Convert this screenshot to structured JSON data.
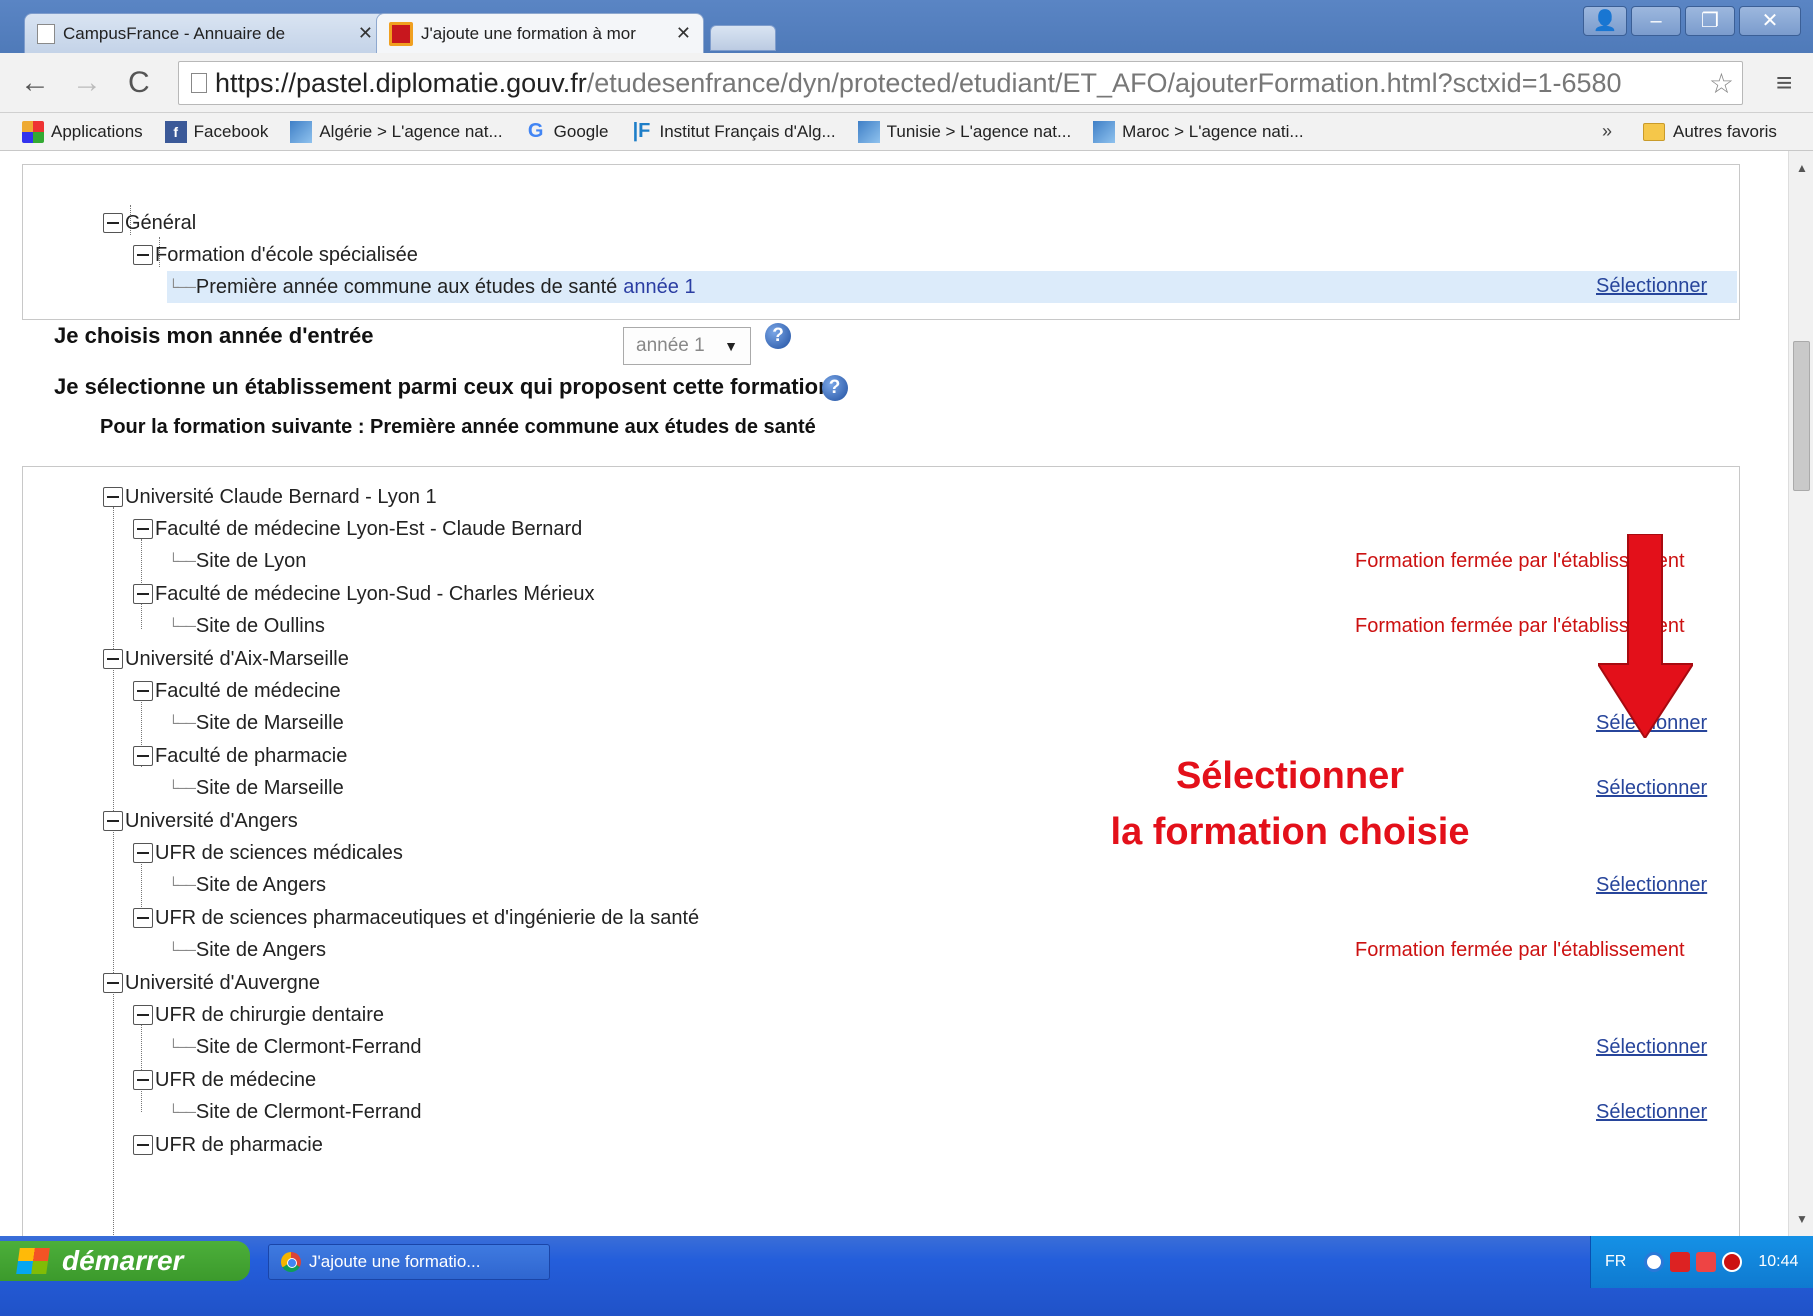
{
  "browser": {
    "tabs": [
      {
        "title": "CampusFrance - Annuaire de",
        "close": "✕"
      },
      {
        "title": "J'ajoute une formation à mor",
        "close": "✕"
      }
    ],
    "url_host": "https://pastel.diplomatie.gouv.fr",
    "url_path": "/etudesenfrance/dyn/protected/etudiant/ET_AFO/ajouterFormation.html?sctxid=1-6580",
    "bookmarks": [
      {
        "label": "Applications",
        "icon": "apps-icon"
      },
      {
        "label": "Facebook",
        "icon": "facebook-icon"
      },
      {
        "label": "Algérie > L'agence nat...",
        "icon": "flag-icon"
      },
      {
        "label": "Google",
        "icon": "google-icon"
      },
      {
        "label": "Institut Français d'Alg...",
        "icon": "if-icon"
      },
      {
        "label": "Tunisie > L'agence nat...",
        "icon": "flag-icon"
      },
      {
        "label": "Maroc > L'agence nati...",
        "icon": "flag-icon"
      }
    ],
    "bookmarks_more": "»",
    "other_bookmarks": "Autres favoris"
  },
  "formation_tree": {
    "root": "Général",
    "child": "Formation d'école spécialisée",
    "leaf": "Première année commune aux études de santé",
    "leaf_year": "année 1",
    "select_label": "Sélectionner"
  },
  "year_section": {
    "label": "Je choisis mon année d'entrée",
    "selected": "année 1"
  },
  "establishment_heading": "Je sélectionne un établissement parmi ceux qui proposent cette formation",
  "for_formation": "Pour la formation suivante : Première année commune aux études de santé",
  "etablissements": [
    {
      "label": "Université Claude Bernard - Lyon 1"
    },
    {
      "label": "Faculté de médecine Lyon-Est - Claude Bernard"
    },
    {
      "label": "Site de Lyon",
      "status": "Formation fermée par l'établissement"
    },
    {
      "label": "Faculté de médecine Lyon-Sud - Charles Mérieux"
    },
    {
      "label": "Site de Oullins",
      "status": "Formation fermée par l'établissement"
    },
    {
      "label": "Université d'Aix-Marseille"
    },
    {
      "label": "Faculté de médecine"
    },
    {
      "label": "Site de Marseille",
      "action": "Sélectionner"
    },
    {
      "label": "Faculté de pharmacie"
    },
    {
      "label": "Site de Marseille",
      "action": "Sélectionner"
    },
    {
      "label": "Université d'Angers"
    },
    {
      "label": "UFR de sciences médicales"
    },
    {
      "label": "Site de Angers",
      "action": "Sélectionner"
    },
    {
      "label": "UFR de sciences pharmaceutiques et d'ingénierie de la santé"
    },
    {
      "label": "Site de Angers",
      "status": "Formation fermée par l'établissement"
    },
    {
      "label": "Université d'Auvergne"
    },
    {
      "label": "UFR de chirurgie dentaire"
    },
    {
      "label": "Site de Clermont-Ferrand",
      "action": "Sélectionner"
    },
    {
      "label": "UFR de médecine"
    },
    {
      "label": "Site de Clermont-Ferrand",
      "action": "Sélectionner"
    },
    {
      "label": "UFR de pharmacie"
    }
  ],
  "annotation": {
    "line1": "Sélectionner",
    "line2": "la formation choisie",
    "color": "#e3101a"
  },
  "taskbar": {
    "start": "démarrer",
    "task": "J'ajoute une formatio...",
    "lang": "FR",
    "clock": "10:44"
  }
}
